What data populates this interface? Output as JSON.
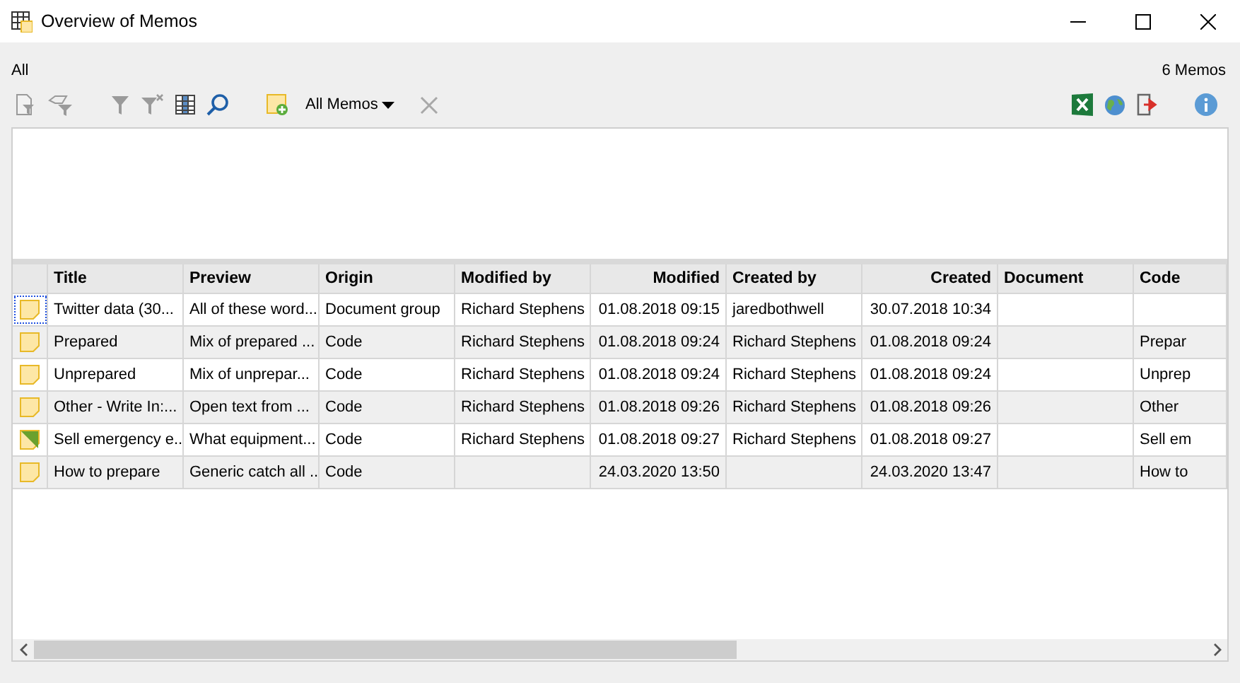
{
  "window": {
    "title": "Overview of Memos"
  },
  "filter_label": "All",
  "count": "6 Memos",
  "toolbar": {
    "dropdown": "All Memos"
  },
  "table": {
    "columns": [
      {
        "label": "Title"
      },
      {
        "label": "Preview"
      },
      {
        "label": "Origin"
      },
      {
        "label": "Modified by"
      },
      {
        "label": "Modified"
      },
      {
        "label": "Created by"
      },
      {
        "label": "Created"
      },
      {
        "label": "Document"
      },
      {
        "label": "Code"
      }
    ],
    "rows": [
      {
        "kind": "memo",
        "focused": true,
        "cells": [
          "Twitter data (30...",
          "All of these word...",
          "Document group",
          "Richard Stephens",
          "01.08.2018 09:15",
          "jaredbothwell",
          "30.07.2018 10:34",
          "",
          ""
        ]
      },
      {
        "kind": "memo",
        "focused": false,
        "cells": [
          "Prepared",
          "Mix of prepared ...",
          "Code",
          "Richard Stephens",
          "01.08.2018 09:24",
          "Richard Stephens",
          "01.08.2018 09:24",
          "",
          "Prepar"
        ]
      },
      {
        "kind": "memo",
        "focused": false,
        "cells": [
          "Unprepared",
          "Mix of unprepar...",
          "Code",
          "Richard Stephens",
          "01.08.2018 09:24",
          "Richard Stephens",
          "01.08.2018 09:24",
          "",
          "Unprep"
        ]
      },
      {
        "kind": "memo",
        "focused": false,
        "cells": [
          "Other - Write In:...",
          "Open text from ...",
          "Code",
          "Richard Stephens",
          "01.08.2018 09:26",
          "Richard Stephens",
          "01.08.2018 09:26",
          "",
          "Other"
        ]
      },
      {
        "kind": "memo-green",
        "focused": false,
        "cells": [
          "Sell emergency e...",
          "What equipment...",
          "Code",
          "Richard Stephens",
          "01.08.2018 09:27",
          "Richard Stephens",
          "01.08.2018 09:27",
          "",
          "Sell em"
        ]
      },
      {
        "kind": "memo",
        "focused": false,
        "cells": [
          "How to prepare",
          "Generic catch all ...",
          "Code",
          "",
          "24.03.2020 13:50",
          "",
          "24.03.2020 13:47",
          "",
          "How to"
        ]
      }
    ]
  }
}
